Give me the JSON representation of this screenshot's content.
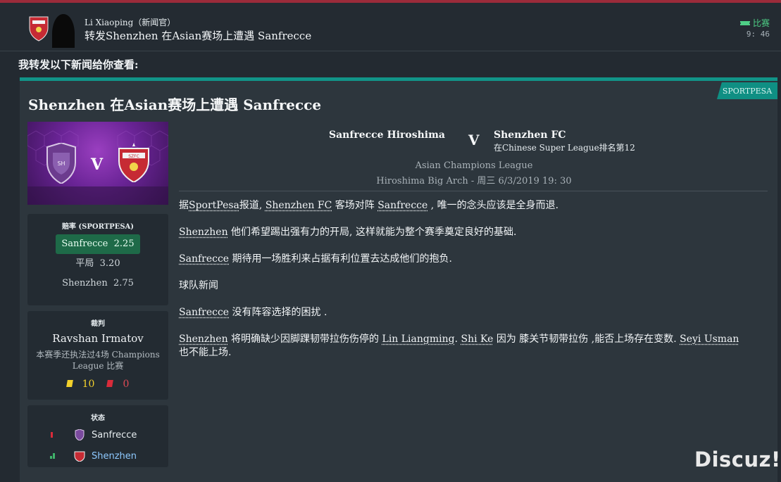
{
  "header": {
    "sender": "Li Xiaoping（新闻官）",
    "subject": "转发Shenzhen 在Asian赛场上遭遇 Sanfrecce",
    "tag": "比赛",
    "time": "9: 46"
  },
  "intro": "我转发以下新闻给你查看:",
  "card": {
    "source": "SPORTPESA",
    "title": "Shenzhen 在Asian赛场上遭遇 Sanfrecce",
    "banner_vs": "V"
  },
  "odds": {
    "title": "赔率 (SPORTPESA)",
    "rows": [
      {
        "team": "Sanfrecce",
        "value": "2.25"
      },
      {
        "team": "平局",
        "value": "3.20"
      },
      {
        "team": "Shenzhen",
        "value": "2.75"
      }
    ]
  },
  "referee": {
    "title": "裁判",
    "name": "Ravshan Irmatov",
    "note": "本赛季还执法过4场 Champions League 比赛",
    "yellow": "10",
    "red": "0"
  },
  "form": {
    "title": "状态",
    "teams": [
      "Sanfrecce",
      "Shenzhen"
    ]
  },
  "match": {
    "home": "Sanfrecce Hiroshima",
    "vs": "V",
    "away": "Shenzhen FC",
    "away_sub": "在Chinese Super League排名第12",
    "competition": "Asian Champions League",
    "venue": "Hiroshima Big Arch - 周三 6/3/2019 19: 30"
  },
  "article": {
    "p1_a": "据",
    "p1_link1": "SportPesa",
    "p1_b": "报道, ",
    "p1_link2": "Shenzhen FC",
    "p1_c": " 客场对阵 ",
    "p1_link3": "Sanfrecce",
    "p1_d": " , 唯一的念头应该是全身而退.",
    "p2_link": "Shenzhen",
    "p2_text": " 他们希望踢出强有力的开局, 这样就能为整个赛季奠定良好的基础.",
    "p3_link": "Sanfrecce",
    "p3_text": " 期待用一场胜利来占据有利位置去达成他们的抱负.",
    "p4": "球队新闻",
    "p5_link": "Sanfrecce",
    "p5_text": " 没有阵容选择的困扰 .",
    "p6_link1": "Shenzhen",
    "p6_a": " 将明确缺少因脚踝韧带拉伤伤停的 ",
    "p6_link2": "Lin Liangming",
    "p6_b": ". ",
    "p6_link3": "Shi Ke",
    "p6_c": " 因为 膝关节韧带拉伤 ,能否上场存在变数. ",
    "p6_link4": "Seyi Usman",
    "p6_d": "也不能上场."
  },
  "watermark": "Discuz!",
  "colors": {
    "accent": "#119488",
    "topbar": "#9b2b3a",
    "highlight_odds": "#1e6a48",
    "yellow_card": "#f3d12b",
    "red_card": "#d92b3a"
  }
}
